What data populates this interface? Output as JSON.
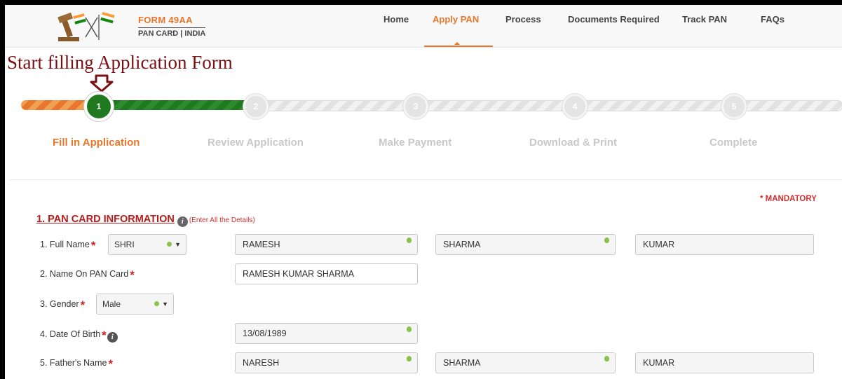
{
  "brand": {
    "title_prefix": "FORM ",
    "title_number": "49AA",
    "subtitle": "PAN CARD | INDIA"
  },
  "nav": {
    "items": [
      "Home",
      "Apply PAN",
      "Process",
      "Documents Required",
      "Track PAN",
      "FAQs"
    ],
    "active": "Apply PAN"
  },
  "annotation": {
    "text": "Start filling Application Form"
  },
  "steps": [
    {
      "number": "1",
      "label": "Fill in Application",
      "state": "active"
    },
    {
      "number": "2",
      "label": "Review Application",
      "state": "pending"
    },
    {
      "number": "3",
      "label": "Make Payment",
      "state": "pending"
    },
    {
      "number": "4",
      "label": "Download & Print",
      "state": "pending"
    },
    {
      "number": "5",
      "label": "Complete",
      "state": "pending"
    }
  ],
  "form": {
    "mandatory_note": "* MANDATORY",
    "section_title": "1. PAN CARD INFORMATION",
    "section_hint": "(Enter All the Details)",
    "full_name": {
      "label": "1. Full Name",
      "title_value": "SHRI",
      "first": "RAMESH",
      "last": "SHARMA",
      "middle": "KUMAR"
    },
    "name_on_card": {
      "label": "2. Name On PAN Card",
      "value": "RAMESH KUMAR SHARMA"
    },
    "gender": {
      "label": "3. Gender",
      "value": "Male"
    },
    "dob": {
      "label": "4. Date Of Birth",
      "value": "13/08/1989"
    },
    "father_name": {
      "label": "5. Father's Name",
      "first": "NARESH",
      "last": "SHARMA",
      "middle": "KUMAR"
    }
  },
  "colors": {
    "accent": "#e8762c",
    "step_active": "#1f7a1f",
    "heading": "#b71c1c",
    "annotation": "#7a0f12",
    "valid": "#8bc34a"
  },
  "icons": {
    "logo": "crossed-flags-gavel-logo",
    "arrow": "arrow-down-icon",
    "info": "info-icon",
    "valid": "check-leaf-icon",
    "caret": "chevron-down-icon"
  }
}
